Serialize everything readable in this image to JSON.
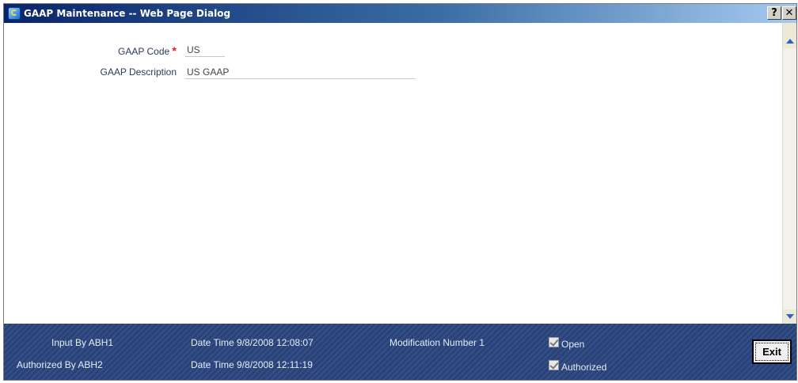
{
  "window": {
    "title": "GAAP Maintenance -- Web Page Dialog",
    "help_label": "?",
    "close_label": "✕"
  },
  "form": {
    "gaap_code_label": "GAAP Code",
    "required_marker": "*",
    "gaap_code_value": "US",
    "gaap_description_label": "GAAP Description",
    "gaap_description_value": "US GAAP"
  },
  "footer": {
    "input_by": "Input By ABH1",
    "input_datetime": "Date Time 9/8/2008 12:08:07",
    "modification_number": "Modification Number 1",
    "open_label": "Open",
    "authorized_by": "Authorized By ABH2",
    "auth_datetime": "Date Time 9/8/2008 12:11:19",
    "authorized_label": "Authorized",
    "exit_label": "Exit"
  },
  "colors": {
    "titlebar_start": "#0a246a",
    "footer_bg": "#2a4275",
    "required": "#e01b1b",
    "label_text": "#2b3a5e"
  }
}
